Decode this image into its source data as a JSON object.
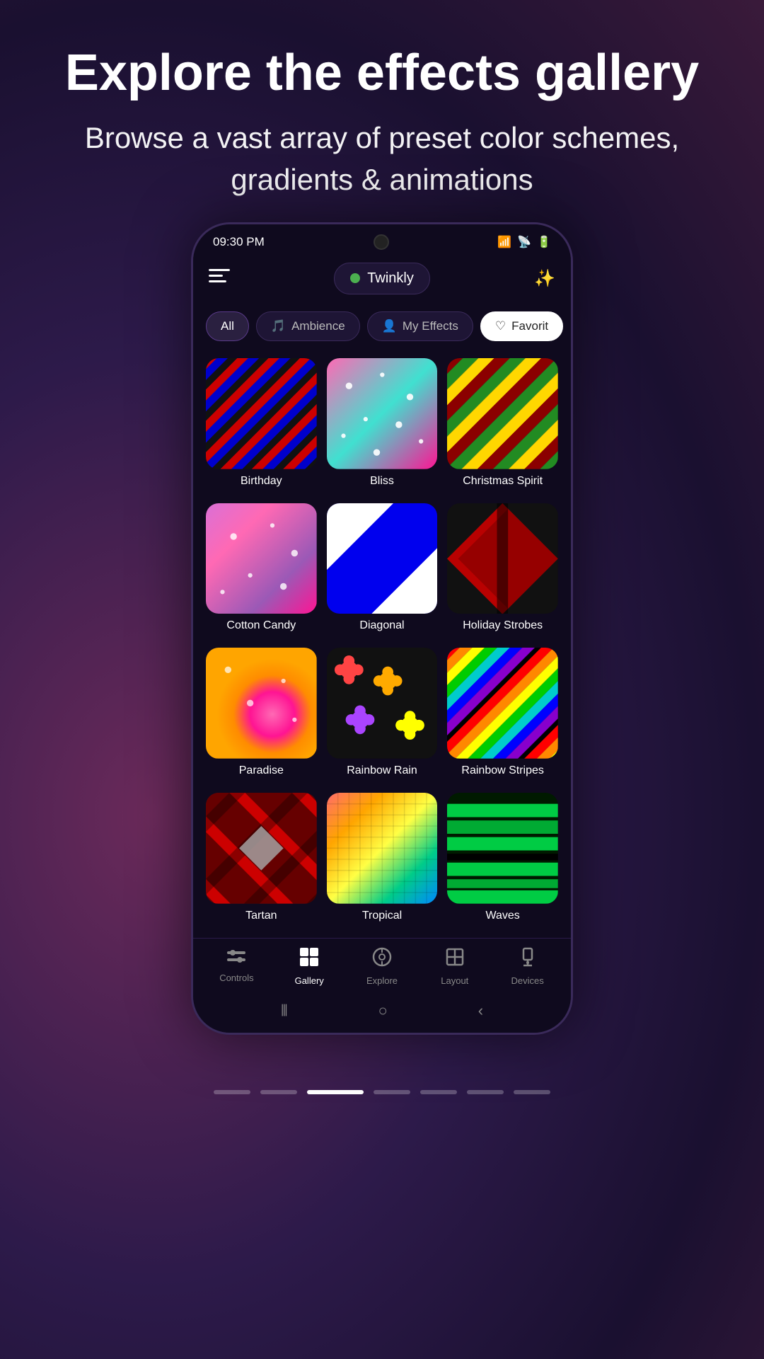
{
  "page": {
    "title": "Explore the effects gallery",
    "subtitle": "Browse a vast array of preset color schemes, gradients & animations"
  },
  "status": {
    "time": "09:30 PM",
    "wifi": "WiFi",
    "signal": "Signal",
    "battery": "Battery"
  },
  "brand": {
    "name": "Twinkly",
    "connected": true
  },
  "filters": [
    {
      "id": "all",
      "label": "All",
      "active": false
    },
    {
      "id": "ambience",
      "label": "Ambience",
      "icon": "🎵",
      "active": false
    },
    {
      "id": "my-effects",
      "label": "My Effects",
      "icon": "👤",
      "active": true
    },
    {
      "id": "favorites",
      "label": "Favorit",
      "icon": "♡",
      "active": false
    }
  ],
  "effects": [
    {
      "id": "birthday",
      "name": "Birthday",
      "type": "birthday"
    },
    {
      "id": "bliss",
      "name": "Bliss",
      "type": "bliss"
    },
    {
      "id": "christmas-spirit",
      "name": "Christmas Spirit",
      "type": "christmas"
    },
    {
      "id": "cotton-candy",
      "name": "Cotton Candy",
      "type": "cotton"
    },
    {
      "id": "diagonal",
      "name": "Diagonal",
      "type": "diagonal"
    },
    {
      "id": "holiday-strobes",
      "name": "Holiday Strobes",
      "type": "holiday"
    },
    {
      "id": "paradise",
      "name": "Paradise",
      "type": "paradise"
    },
    {
      "id": "rainbow-rain",
      "name": "Rainbow Rain",
      "type": "rainbow-rain"
    },
    {
      "id": "rainbow-stripes",
      "name": "Rainbow Stripes",
      "type": "rainbow-stripes"
    },
    {
      "id": "tartan",
      "name": "Tartan",
      "type": "tartan"
    },
    {
      "id": "tropical",
      "name": "Tropical",
      "type": "tropical"
    },
    {
      "id": "waves",
      "name": "Waves",
      "type": "waves"
    }
  ],
  "nav": [
    {
      "id": "controls",
      "label": "Controls",
      "icon": "⊞",
      "active": false
    },
    {
      "id": "gallery",
      "label": "Gallery",
      "icon": "⊟",
      "active": true
    },
    {
      "id": "explore",
      "label": "Explore",
      "icon": "◎",
      "active": false
    },
    {
      "id": "layout",
      "label": "Layout",
      "icon": "#",
      "active": false
    },
    {
      "id": "devices",
      "label": "Devices",
      "icon": "⊡",
      "active": false
    }
  ],
  "page_dots": {
    "total": 7,
    "active": 2
  }
}
